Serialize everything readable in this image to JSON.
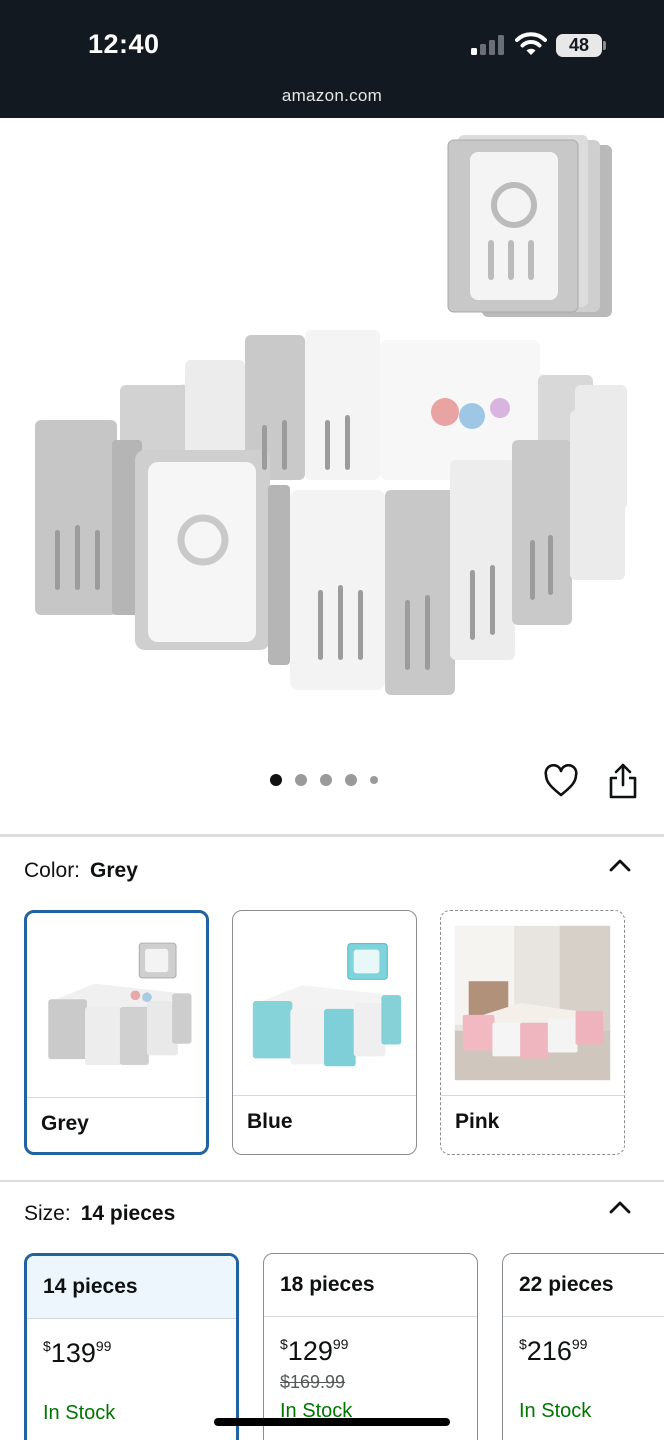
{
  "status_bar": {
    "time": "12:40",
    "battery": "48",
    "url": "amazon.com",
    "icons": [
      "cellular-signal-icon",
      "wifi-icon",
      "battery-icon"
    ]
  },
  "gallery": {
    "image_count": 5,
    "active_index": 0,
    "icons": [
      "heart-icon",
      "share-icon"
    ]
  },
  "color_section": {
    "label": "Color:",
    "selected": "Grey",
    "options": [
      {
        "name": "Grey",
        "selected": true
      },
      {
        "name": "Blue",
        "selected": false
      },
      {
        "name": "Pink",
        "selected": false,
        "unavailable_style": "dashed"
      }
    ]
  },
  "size_section": {
    "label": "Size:",
    "selected": "14 pieces",
    "options": [
      {
        "name": "14 pieces",
        "currency": "$",
        "whole": "139",
        "fraction": "99",
        "list_price": "",
        "stock": "In Stock",
        "selected": true
      },
      {
        "name": "18 pieces",
        "currency": "$",
        "whole": "129",
        "fraction": "99",
        "list_price": "$169.99",
        "stock": "In Stock",
        "selected": false
      },
      {
        "name": "22 pieces",
        "currency": "$",
        "whole": "216",
        "fraction": "99",
        "list_price": "",
        "stock": "In Stock",
        "selected": false
      }
    ]
  },
  "colors": {
    "status_bar_bg": "#131921",
    "selected_border": "#2162a1",
    "stock_green": "#007600"
  }
}
